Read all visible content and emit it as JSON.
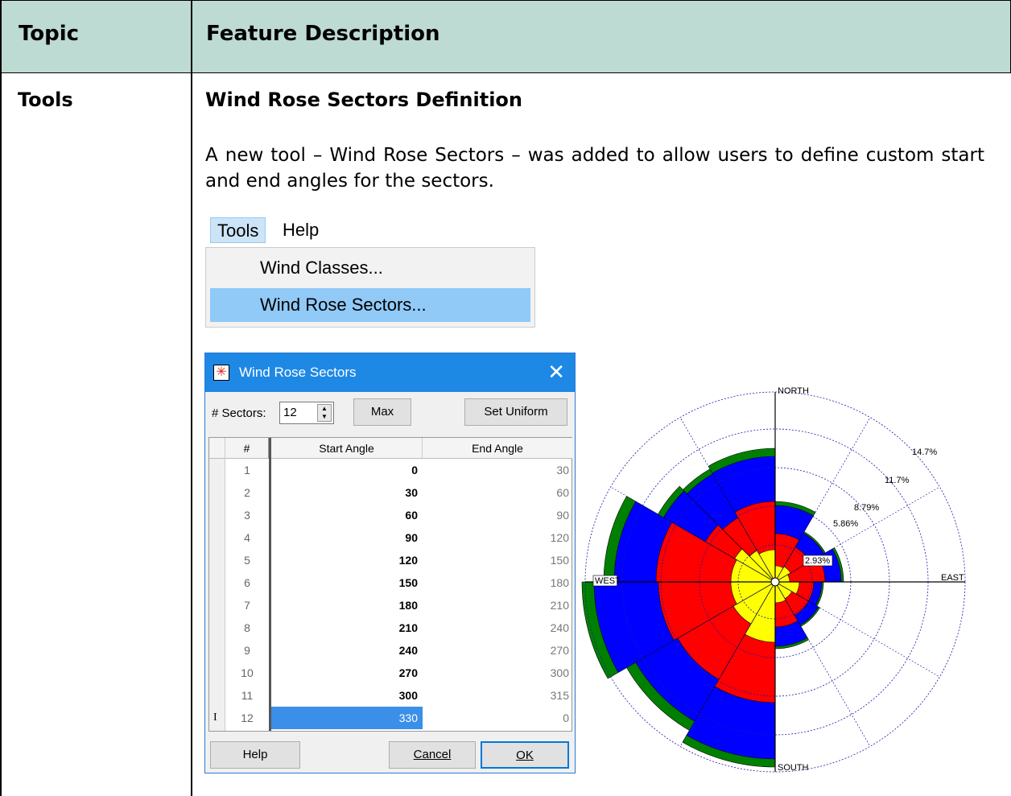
{
  "table": {
    "header": {
      "col1": "Topic",
      "col2": "Feature Description"
    },
    "row": {
      "topic": "Tools",
      "feature_title": "Wind Rose Sectors Definition",
      "description": "A new tool – Wind Rose Sectors – was added to allow users to define custom start and end angles for the sectors."
    }
  },
  "menu": {
    "bar": [
      "Tools",
      "Help"
    ],
    "items": [
      "Wind Classes...",
      "Wind Rose Sectors..."
    ],
    "highlighted_item": "Wind Rose Sectors..."
  },
  "dialog": {
    "title": "Wind Rose Sectors",
    "sectors_label": "# Sectors:",
    "sectors_value": "12",
    "max_label": "Max",
    "set_uniform_label": "Set Uniform",
    "columns": [
      "#",
      "Start Angle",
      "End Angle"
    ],
    "rows": [
      [
        "1",
        "0",
        "30"
      ],
      [
        "2",
        "30",
        "60"
      ],
      [
        "3",
        "60",
        "90"
      ],
      [
        "4",
        "90",
        "120"
      ],
      [
        "5",
        "120",
        "150"
      ],
      [
        "6",
        "150",
        "180"
      ],
      [
        "7",
        "180",
        "210"
      ],
      [
        "8",
        "210",
        "240"
      ],
      [
        "9",
        "240",
        "270"
      ],
      [
        "10",
        "270",
        "300"
      ],
      [
        "11",
        "300",
        "315"
      ],
      [
        "12",
        "330",
        "0"
      ]
    ],
    "selected_row": 12,
    "help_label": "Help",
    "cancel_label": "Cancel",
    "ok_label": "OK"
  },
  "rose": {
    "directions": {
      "north": "NORTH",
      "south": "SOUTH",
      "east": "EAST",
      "west": "WEST"
    },
    "ring_labels": [
      "2.93%",
      "5.86%",
      "8.79%",
      "11.7%",
      "14.7%"
    ],
    "class_colors": [
      "#ffff00",
      "#ff0000",
      "#0000ff",
      "#008000"
    ]
  }
}
